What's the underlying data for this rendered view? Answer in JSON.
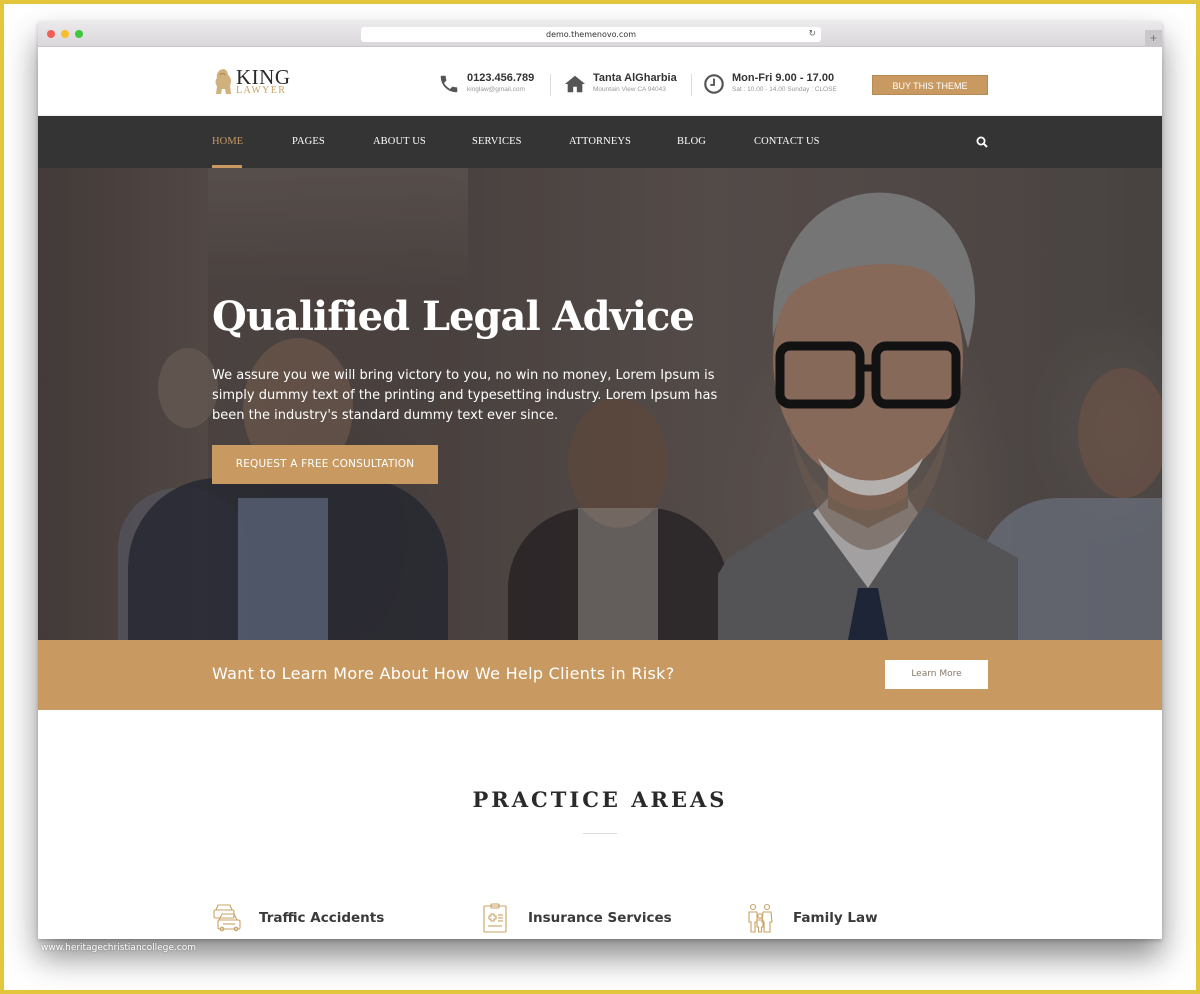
{
  "browser": {
    "url": "demo.themenovo.com",
    "new_tab_label": "+"
  },
  "header": {
    "logo": {
      "brand": "KING",
      "sub": "LAWYER"
    },
    "phone": {
      "title": "0123.456.789",
      "sub": "kinglaw@gmail.com"
    },
    "address": {
      "title": "Tanta AlGharbia",
      "sub": "Mountain View CA 94043"
    },
    "hours": {
      "title": "Mon-Fri 9.00 - 17.00",
      "sub": "Sat : 10.00 - 14.00 Sunday : CLOSE"
    },
    "buy_button": "BUY THIS THEME"
  },
  "nav": {
    "items": [
      {
        "label": "HOME",
        "active": true
      },
      {
        "label": "PAGES"
      },
      {
        "label": "ABOUT US"
      },
      {
        "label": "SERVICES"
      },
      {
        "label": "ATTORNEYS"
      },
      {
        "label": "BLOG"
      },
      {
        "label": "CONTACT US"
      }
    ]
  },
  "hero": {
    "title": "Qualified Legal Advice",
    "text": "We assure you we will bring victory to you, no win no money, Lorem Ipsum is simply dummy text of the printing and typesetting industry. Lorem Ipsum has been the industry's standard dummy text ever since.",
    "cta": "REQUEST A FREE CONSULTATION"
  },
  "band": {
    "text": "Want to Learn More About How We Help Clients in Risk?",
    "button": "Learn More"
  },
  "practice": {
    "title": "PRACTICE AREAS",
    "items": [
      {
        "label": "Traffic Accidents",
        "icon": "cars-icon"
      },
      {
        "label": "Insurance Services",
        "icon": "clipboard-icon"
      },
      {
        "label": "Family Law",
        "icon": "family-icon"
      }
    ]
  },
  "colors": {
    "accent": "#c89a62",
    "nav_bg": "#343434",
    "frame": "#e3c63c"
  },
  "watermark": "www.heritagechristiancollege.com"
}
